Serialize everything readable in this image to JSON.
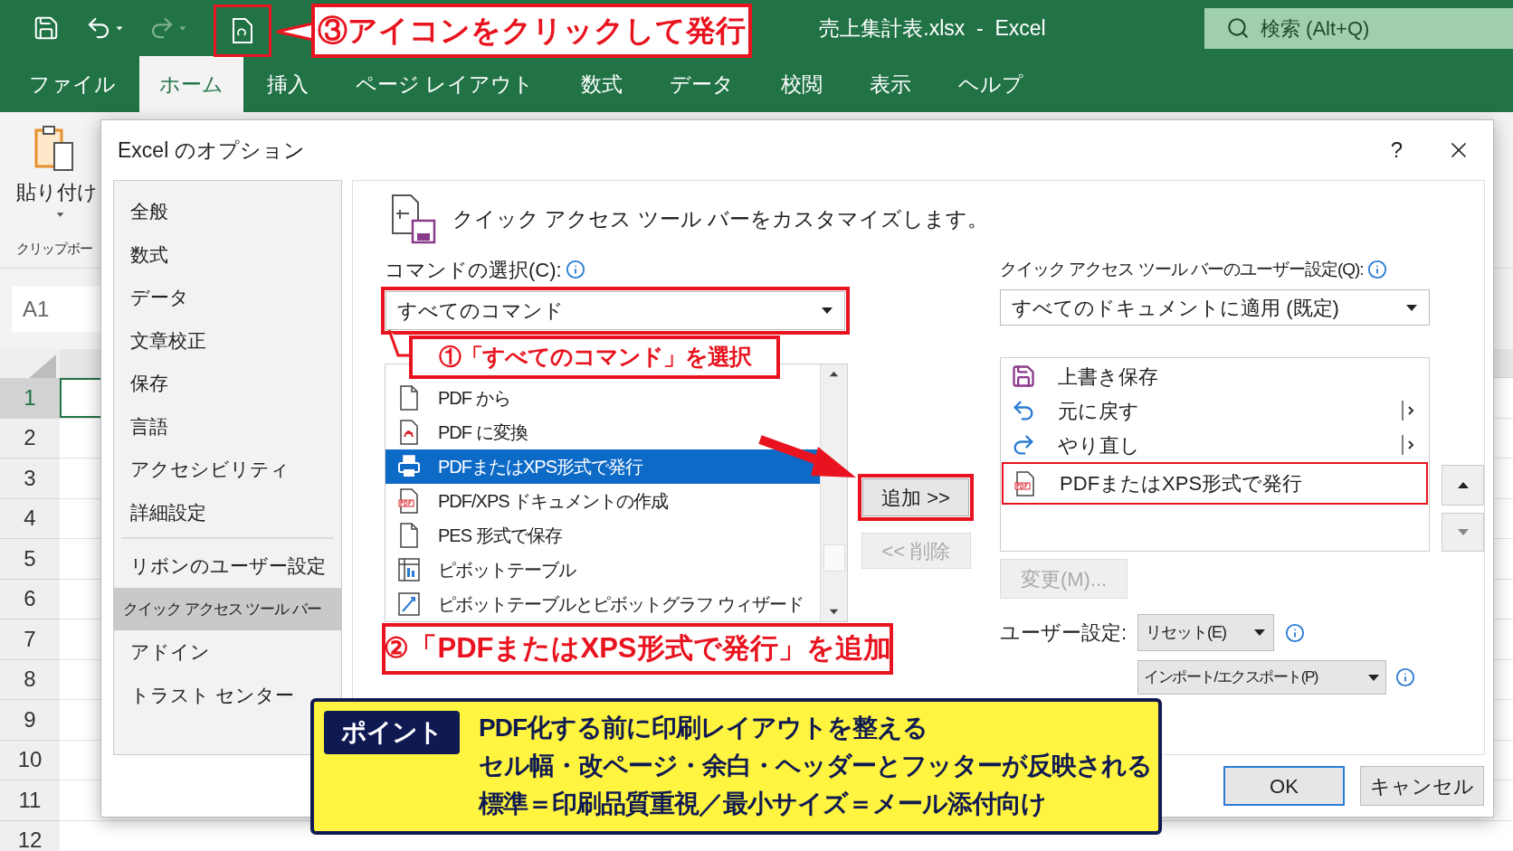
{
  "title_bar": {
    "file_title": "売上集計表.xlsx  -  Excel",
    "search_placeholder": "検索 (Alt+Q)"
  },
  "ribbon_tabs": [
    {
      "label": "ファイル",
      "selected": false
    },
    {
      "label": "ホーム",
      "selected": true
    },
    {
      "label": "挿入",
      "selected": false
    },
    {
      "label": "ページ レイアウト",
      "selected": false
    },
    {
      "label": "数式",
      "selected": false
    },
    {
      "label": "データ",
      "selected": false
    },
    {
      "label": "校閲",
      "selected": false
    },
    {
      "label": "表示",
      "selected": false
    },
    {
      "label": "ヘルプ",
      "selected": false
    }
  ],
  "ribbon": {
    "paste_label": "貼り付け",
    "clipboard_label": "クリップボー"
  },
  "name_box": "A1",
  "rows": [
    {
      "label": "1",
      "selected": true
    },
    {
      "label": "2",
      "selected": false
    },
    {
      "label": "3",
      "selected": false
    },
    {
      "label": "4",
      "selected": false
    },
    {
      "label": "5",
      "selected": false
    },
    {
      "label": "6",
      "selected": false
    },
    {
      "label": "7",
      "selected": false
    },
    {
      "label": "8",
      "selected": false
    },
    {
      "label": "9",
      "selected": false
    },
    {
      "label": "10",
      "selected": false
    },
    {
      "label": "11",
      "selected": false
    },
    {
      "label": "12",
      "selected": false
    }
  ],
  "dialog": {
    "title": "Excel のオプション",
    "help": "?",
    "nav_groups": [
      [
        {
          "label": "全般",
          "selected": false
        },
        {
          "label": "数式",
          "selected": false
        },
        {
          "label": "データ",
          "selected": false
        },
        {
          "label": "文章校正",
          "selected": false
        },
        {
          "label": "保存",
          "selected": false
        },
        {
          "label": "言語",
          "selected": false
        },
        {
          "label": "アクセシビリティ",
          "selected": false
        },
        {
          "label": "詳細設定",
          "selected": false
        }
      ],
      [
        {
          "label": "リボンのユーザー設定",
          "selected": false
        },
        {
          "label": "クイック アクセス ツール バー",
          "selected": true
        },
        {
          "label": "アドイン",
          "selected": false
        },
        {
          "label": "トラスト センター",
          "selected": false
        }
      ]
    ],
    "heading": "クイック アクセス ツール バーをカスタマイズします。",
    "commands_label": "コマンドの選択(C):",
    "commands_dropdown": "すべてのコマンド",
    "commands": [
      {
        "label": "PDF から",
        "kind": "doc",
        "selected": false
      },
      {
        "label": "PDF に変換",
        "kind": "convert",
        "selected": false
      },
      {
        "label": "PDFまたはXPS形式で発行",
        "kind": "printer",
        "selected": true
      },
      {
        "label": "PDF/XPS ドキュメントの作成",
        "kind": "pdf",
        "selected": false
      },
      {
        "label": "PES 形式で保存",
        "kind": "doc",
        "selected": false
      },
      {
        "label": "ピボットテーブル",
        "kind": "pivot",
        "selected": false
      },
      {
        "label": "ピボットテーブルとピボットグラフ ウィザード",
        "kind": "wizard",
        "selected": false
      }
    ],
    "add_button": "追加 >>",
    "remove_button": {
      "label": "<< 削除",
      "disabled": true
    },
    "qat_label": "クイック アクセス ツール バーのユーザー設定(Q):",
    "qat_dropdown": "すべてのドキュメントに適用 (既定)",
    "qat_items": [
      {
        "label": "上書き保存",
        "kind": "save",
        "submenu": false,
        "highlighted": false
      },
      {
        "label": "元に戻す",
        "kind": "undo",
        "submenu": true,
        "highlighted": false
      },
      {
        "label": "やり直し",
        "kind": "redo",
        "submenu": true,
        "highlighted": false
      },
      {
        "label": "PDFまたはXPS形式で発行",
        "kind": "pdf",
        "submenu": false,
        "highlighted": true
      }
    ],
    "modify_button": {
      "label": "変更(M)...",
      "disabled": true
    },
    "user_settings_label": "ユーザー設定:",
    "reset_dropdown": "リセット(E)",
    "import_export_dropdown": "インポート/エクスポート(P)",
    "ok": "OK",
    "cancel": "キャンセル"
  },
  "annotations": {
    "step3": "③アイコンをクリックして発行",
    "step1": "①「すべてのコマンド」を選択",
    "step2": "②「PDFまたはXPS形式で発行」を追加"
  },
  "point": {
    "badge": "ポイント",
    "lines": [
      "PDF化する前に印刷レイアウトを整える",
      "セル幅・改ページ・余白・ヘッダーとフッターが反映される",
      "標準＝印刷品質重視／最小サイズ＝メール添付向け"
    ]
  }
}
